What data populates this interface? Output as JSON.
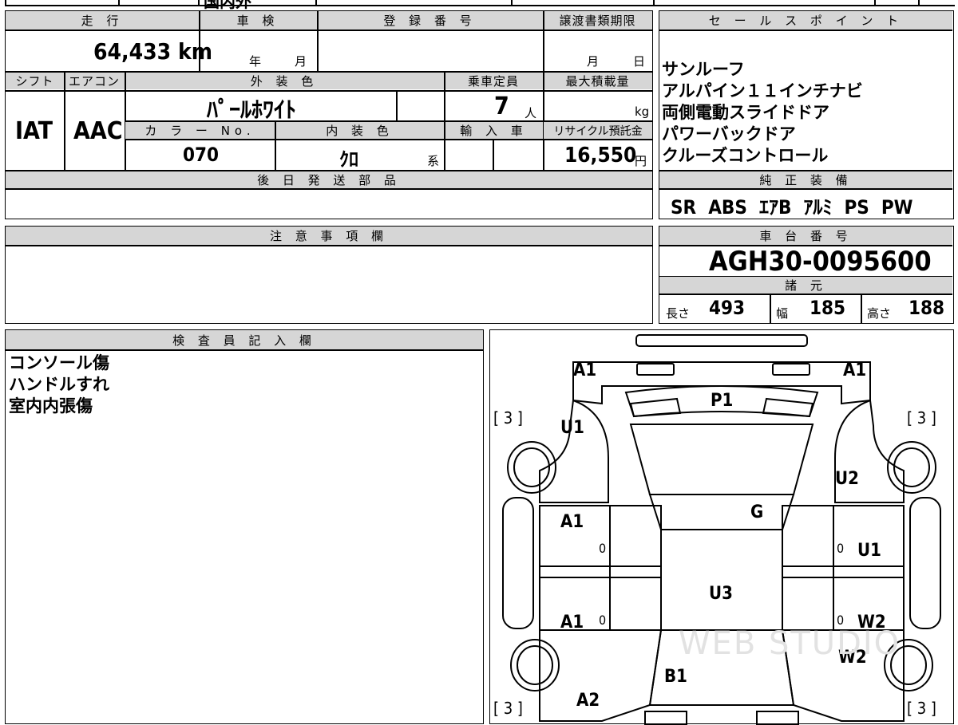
{
  "top_strip": {
    "partial_text": "国内外"
  },
  "main": {
    "h_mileage": "走 行",
    "h_inspection": "車 検",
    "h_registration": "登 録 番 号",
    "h_transfer": "譲渡書類期限",
    "mileage": "64,433 km",
    "insp_year": "年",
    "insp_month": "月",
    "transfer_month": "月",
    "transfer_day": "日",
    "h_shift": "シフト",
    "h_aircon": "エアコン",
    "h_exterior": "外 装 色",
    "h_capacity": "乗車定員",
    "h_maxload": "最大積載量",
    "shift": "IAT",
    "aircon": "AAC",
    "exterior_color": "ﾊﾟｰﾙﾎﾜｲﾄ",
    "capacity": "7",
    "capacity_unit": "人",
    "maxload_unit": "kg",
    "h_color_no": "カ ラ ー No.",
    "h_interior": "内 装 色",
    "h_import": "輸 入 車",
    "h_recycle": "リサイクル預託金",
    "color_no": "070",
    "interior_color": "ｸﾛ",
    "interior_suffix": "系",
    "recycle_fee": "16,550",
    "recycle_unit": "円",
    "h_later_parts": "後 日 発 送 部 品"
  },
  "sales_points": {
    "header": "セ ー ル ス ポ イ ン ト",
    "items": [
      "サンルーフ",
      "アルパイン１１インチナビ",
      "両側電動スライドドア",
      "パワーバックドア",
      "クルーズコントロール"
    ]
  },
  "standard_equipment": {
    "header": "純 正 装 備",
    "value": "SR  ABS  ｴｱB  ｱﾙﾐ  PS  PW"
  },
  "notes": {
    "header": "注 意 事 項 欄"
  },
  "chassis": {
    "header": "車 台 番 号",
    "number": "AGH30-0095600",
    "spec_header": "諸 元",
    "length_label": "長さ",
    "length": "493",
    "width_label": "幅",
    "width": "185",
    "height_label": "高さ",
    "height": "188"
  },
  "inspector": {
    "header": "検 査 員 記 入 欄",
    "comments": [
      "コンソール傷",
      "ハンドルすれ",
      "室内内張傷"
    ]
  },
  "diagram": {
    "a1_front_left": "A1",
    "a1_front_right": "A1",
    "p1": "P1",
    "bracket_tl": "[ 3 ]",
    "bracket_tr": "[ 3 ]",
    "bracket_bl": "[ 3 ]",
    "bracket_br": "[ 3 ]",
    "u1_left": "U1",
    "u2_right": "U2",
    "g": "G",
    "a1_left_door_front": "A1",
    "a1_left_door_rear": "A1",
    "u1_right_door": "U1",
    "w2_right_door": "W2",
    "u3": "U3",
    "w2_right_rear": "W2",
    "b1": "B1",
    "a2": "A2",
    "zero_1": "0",
    "zero_2": "0",
    "zero_3": "0",
    "zero_4": "0",
    "watermark": "WEB STUDIO"
  }
}
